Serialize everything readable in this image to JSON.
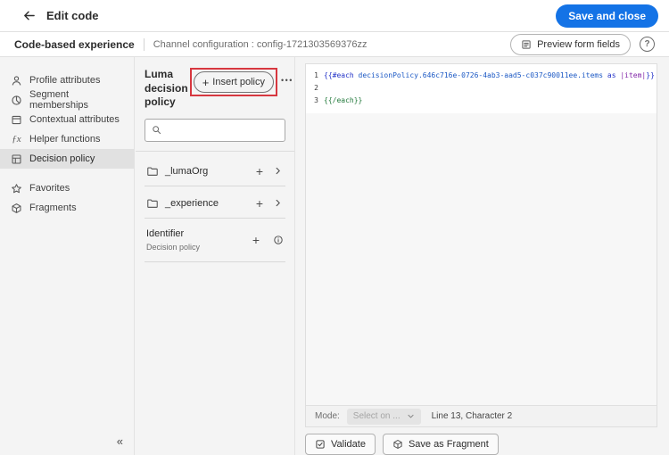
{
  "colors": {
    "accent_blue": "#1473e6",
    "annotation_red": "#d7373f",
    "selected_item_gray": "#e1e1e1"
  },
  "header": {
    "title": "Edit code",
    "save_button_label": "Save and close"
  },
  "subheader": {
    "experience_label": "Code-based experience",
    "channel_config": "Channel configuration : config-1721303569376zz",
    "preview_button_label": "Preview form fields",
    "help_label": "?"
  },
  "sidebar": {
    "items": [
      {
        "label": "Profile attributes",
        "icon": "person-icon",
        "selected": false
      },
      {
        "label": "Segment memberships",
        "icon": "segments-icon",
        "selected": false
      },
      {
        "label": "Contextual attributes",
        "icon": "contextual-attributes-icon",
        "selected": false
      },
      {
        "label": "Helper functions",
        "icon": "function-icon",
        "selected": false
      },
      {
        "label": "Decision policy",
        "icon": "decision-policy-icon",
        "selected": true
      },
      {
        "label": "Favorites",
        "icon": "star-icon",
        "selected": false
      },
      {
        "label": "Fragments",
        "icon": "fragment-icon",
        "selected": false
      }
    ],
    "collapse_label": "«"
  },
  "policy_panel": {
    "title": "Luma decision policy",
    "insert_button_plus": "+",
    "insert_button_label": "Insert policy",
    "more_button_label": "•••",
    "search": {
      "value": "",
      "placeholder": ""
    },
    "rows": [
      {
        "type": "folder",
        "label": "_lumaOrg"
      },
      {
        "type": "folder",
        "label": "_experience"
      }
    ],
    "identifier_row": {
      "label": "Identifier",
      "sublabel": "Decision policy"
    }
  },
  "editor": {
    "lines": [
      {
        "number": "1",
        "segments": [
          {
            "text": "{{#each ",
            "color": "blue"
          },
          {
            "text": "decisionPolicy.646c716e-0726-4ab3-aad5-c037c90011ee.items",
            "color": "navy"
          },
          {
            "text": " as ",
            "color": "blue"
          },
          {
            "text": "|item|",
            "color": "purple"
          },
          {
            "text": "}}",
            "color": "blue"
          }
        ]
      },
      {
        "number": "2",
        "segments": []
      },
      {
        "number": "3",
        "segments": [
          {
            "text": "{{/each}}",
            "color": "green"
          }
        ]
      }
    ],
    "status": {
      "mode_label": "Mode:",
      "mode_value": "Select on ...",
      "cursor_position": "Line 13, Character 2"
    },
    "validate_button_label": "Validate",
    "save_fragment_button_label": "Save as Fragment"
  }
}
